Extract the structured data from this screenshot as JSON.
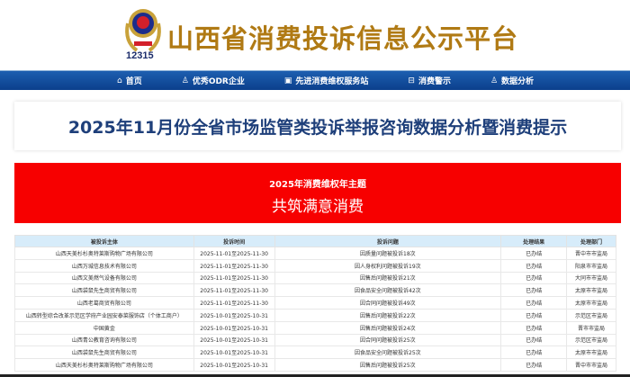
{
  "header": {
    "site_title": "山西省消费投诉信息公示平台",
    "hotline": "12315"
  },
  "nav": [
    {
      "icon": "home-icon",
      "glyph": "⌂",
      "label": "首页"
    },
    {
      "icon": "users-icon",
      "glyph": "♙",
      "label": "优秀ODR企业"
    },
    {
      "icon": "book-icon",
      "glyph": "▣",
      "label": "先进消费维权服务站"
    },
    {
      "icon": "briefcase-icon",
      "glyph": "⊟",
      "label": "消费警示"
    },
    {
      "icon": "users-icon",
      "glyph": "♙",
      "label": "数据分析"
    }
  ],
  "report_title": "2025年11月份全省市场监管类投诉举报咨询数据分析暨消费提示",
  "banner": {
    "subtitle": "2025年消费维权年主题",
    "theme": "共筑满意消费"
  },
  "table": {
    "headers": [
      "被投诉主体",
      "投诉时间",
      "投诉问题",
      "处理结果",
      "处理部门"
    ],
    "rows": [
      [
        "山西天美杉杉奥特莱斯购物广场有限公司",
        "2025-11-01至2025-11-30",
        "因质量问题被投诉18次",
        "已办结",
        "晋中市市监局"
      ],
      [
        "山西万城信息技术有限公司",
        "2025-11-01至2025-11-30",
        "因人身权利问题被投诉19次",
        "已办结",
        "阳泉市市监局"
      ],
      [
        "山西文美燃气设备有限公司",
        "2025-11-01至2025-11-30",
        "因售后问题被投诉21次",
        "已办结",
        "大同市市监局"
      ],
      [
        "山西袋鼠先生商贸有限公司",
        "2025-11-01至2025-11-30",
        "因食品安全问题被投诉42次",
        "已办结",
        "太原市市监局"
      ],
      [
        "山西老葛商贸有限公司",
        "2025-11-01至2025-11-30",
        "因合同问题被投诉49次",
        "已办结",
        "太原市市监局"
      ],
      [
        "山西转型综合改革示范区学府产业园安泰菜服饰店（个体工商户）",
        "2025-10-01至2025-10-31",
        "因售后问题被投诉22次",
        "已办结",
        "示范区市监局"
      ],
      [
        "中国黄金",
        "2025-10-01至2025-10-31",
        "因售后问题被投诉24次",
        "已办结",
        "晋市市监局"
      ],
      [
        "山西青公教育咨询有限公司",
        "2025-10-01至2025-10-31",
        "因合同问题被投诉25次",
        "已办结",
        "示范区市监局"
      ],
      [
        "山西袋鼠先生商贸有限公司",
        "2025-10-01至2025-10-31",
        "因食品安全问题被投诉25次",
        "已办结",
        "太原市市监局"
      ],
      [
        "山西天美杉杉奥特莱斯购物广场有限公司",
        "2025-10-01至2025-10-31",
        "因售后问题被投诉25次",
        "已办结",
        "晋中市市监局"
      ]
    ]
  }
}
